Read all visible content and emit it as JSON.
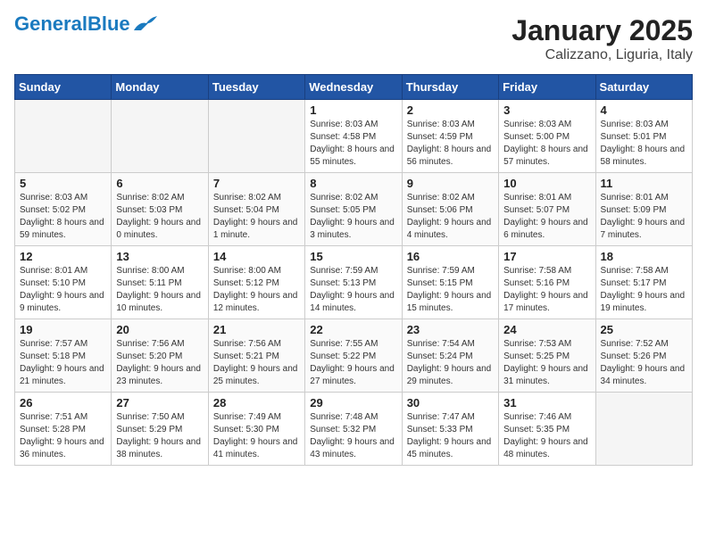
{
  "header": {
    "logo_general": "General",
    "logo_blue": "Blue",
    "month": "January 2025",
    "location": "Calizzano, Liguria, Italy"
  },
  "days_of_week": [
    "Sunday",
    "Monday",
    "Tuesday",
    "Wednesday",
    "Thursday",
    "Friday",
    "Saturday"
  ],
  "weeks": [
    [
      {
        "day": "",
        "sunrise": "",
        "sunset": "",
        "daylight": ""
      },
      {
        "day": "",
        "sunrise": "",
        "sunset": "",
        "daylight": ""
      },
      {
        "day": "",
        "sunrise": "",
        "sunset": "",
        "daylight": ""
      },
      {
        "day": "1",
        "sunrise": "Sunrise: 8:03 AM",
        "sunset": "Sunset: 4:58 PM",
        "daylight": "Daylight: 8 hours and 55 minutes."
      },
      {
        "day": "2",
        "sunrise": "Sunrise: 8:03 AM",
        "sunset": "Sunset: 4:59 PM",
        "daylight": "Daylight: 8 hours and 56 minutes."
      },
      {
        "day": "3",
        "sunrise": "Sunrise: 8:03 AM",
        "sunset": "Sunset: 5:00 PM",
        "daylight": "Daylight: 8 hours and 57 minutes."
      },
      {
        "day": "4",
        "sunrise": "Sunrise: 8:03 AM",
        "sunset": "Sunset: 5:01 PM",
        "daylight": "Daylight: 8 hours and 58 minutes."
      }
    ],
    [
      {
        "day": "5",
        "sunrise": "Sunrise: 8:03 AM",
        "sunset": "Sunset: 5:02 PM",
        "daylight": "Daylight: 8 hours and 59 minutes."
      },
      {
        "day": "6",
        "sunrise": "Sunrise: 8:02 AM",
        "sunset": "Sunset: 5:03 PM",
        "daylight": "Daylight: 9 hours and 0 minutes."
      },
      {
        "day": "7",
        "sunrise": "Sunrise: 8:02 AM",
        "sunset": "Sunset: 5:04 PM",
        "daylight": "Daylight: 9 hours and 1 minute."
      },
      {
        "day": "8",
        "sunrise": "Sunrise: 8:02 AM",
        "sunset": "Sunset: 5:05 PM",
        "daylight": "Daylight: 9 hours and 3 minutes."
      },
      {
        "day": "9",
        "sunrise": "Sunrise: 8:02 AM",
        "sunset": "Sunset: 5:06 PM",
        "daylight": "Daylight: 9 hours and 4 minutes."
      },
      {
        "day": "10",
        "sunrise": "Sunrise: 8:01 AM",
        "sunset": "Sunset: 5:07 PM",
        "daylight": "Daylight: 9 hours and 6 minutes."
      },
      {
        "day": "11",
        "sunrise": "Sunrise: 8:01 AM",
        "sunset": "Sunset: 5:09 PM",
        "daylight": "Daylight: 9 hours and 7 minutes."
      }
    ],
    [
      {
        "day": "12",
        "sunrise": "Sunrise: 8:01 AM",
        "sunset": "Sunset: 5:10 PM",
        "daylight": "Daylight: 9 hours and 9 minutes."
      },
      {
        "day": "13",
        "sunrise": "Sunrise: 8:00 AM",
        "sunset": "Sunset: 5:11 PM",
        "daylight": "Daylight: 9 hours and 10 minutes."
      },
      {
        "day": "14",
        "sunrise": "Sunrise: 8:00 AM",
        "sunset": "Sunset: 5:12 PM",
        "daylight": "Daylight: 9 hours and 12 minutes."
      },
      {
        "day": "15",
        "sunrise": "Sunrise: 7:59 AM",
        "sunset": "Sunset: 5:13 PM",
        "daylight": "Daylight: 9 hours and 14 minutes."
      },
      {
        "day": "16",
        "sunrise": "Sunrise: 7:59 AM",
        "sunset": "Sunset: 5:15 PM",
        "daylight": "Daylight: 9 hours and 15 minutes."
      },
      {
        "day": "17",
        "sunrise": "Sunrise: 7:58 AM",
        "sunset": "Sunset: 5:16 PM",
        "daylight": "Daylight: 9 hours and 17 minutes."
      },
      {
        "day": "18",
        "sunrise": "Sunrise: 7:58 AM",
        "sunset": "Sunset: 5:17 PM",
        "daylight": "Daylight: 9 hours and 19 minutes."
      }
    ],
    [
      {
        "day": "19",
        "sunrise": "Sunrise: 7:57 AM",
        "sunset": "Sunset: 5:18 PM",
        "daylight": "Daylight: 9 hours and 21 minutes."
      },
      {
        "day": "20",
        "sunrise": "Sunrise: 7:56 AM",
        "sunset": "Sunset: 5:20 PM",
        "daylight": "Daylight: 9 hours and 23 minutes."
      },
      {
        "day": "21",
        "sunrise": "Sunrise: 7:56 AM",
        "sunset": "Sunset: 5:21 PM",
        "daylight": "Daylight: 9 hours and 25 minutes."
      },
      {
        "day": "22",
        "sunrise": "Sunrise: 7:55 AM",
        "sunset": "Sunset: 5:22 PM",
        "daylight": "Daylight: 9 hours and 27 minutes."
      },
      {
        "day": "23",
        "sunrise": "Sunrise: 7:54 AM",
        "sunset": "Sunset: 5:24 PM",
        "daylight": "Daylight: 9 hours and 29 minutes."
      },
      {
        "day": "24",
        "sunrise": "Sunrise: 7:53 AM",
        "sunset": "Sunset: 5:25 PM",
        "daylight": "Daylight: 9 hours and 31 minutes."
      },
      {
        "day": "25",
        "sunrise": "Sunrise: 7:52 AM",
        "sunset": "Sunset: 5:26 PM",
        "daylight": "Daylight: 9 hours and 34 minutes."
      }
    ],
    [
      {
        "day": "26",
        "sunrise": "Sunrise: 7:51 AM",
        "sunset": "Sunset: 5:28 PM",
        "daylight": "Daylight: 9 hours and 36 minutes."
      },
      {
        "day": "27",
        "sunrise": "Sunrise: 7:50 AM",
        "sunset": "Sunset: 5:29 PM",
        "daylight": "Daylight: 9 hours and 38 minutes."
      },
      {
        "day": "28",
        "sunrise": "Sunrise: 7:49 AM",
        "sunset": "Sunset: 5:30 PM",
        "daylight": "Daylight: 9 hours and 41 minutes."
      },
      {
        "day": "29",
        "sunrise": "Sunrise: 7:48 AM",
        "sunset": "Sunset: 5:32 PM",
        "daylight": "Daylight: 9 hours and 43 minutes."
      },
      {
        "day": "30",
        "sunrise": "Sunrise: 7:47 AM",
        "sunset": "Sunset: 5:33 PM",
        "daylight": "Daylight: 9 hours and 45 minutes."
      },
      {
        "day": "31",
        "sunrise": "Sunrise: 7:46 AM",
        "sunset": "Sunset: 5:35 PM",
        "daylight": "Daylight: 9 hours and 48 minutes."
      },
      {
        "day": "",
        "sunrise": "",
        "sunset": "",
        "daylight": ""
      }
    ]
  ]
}
